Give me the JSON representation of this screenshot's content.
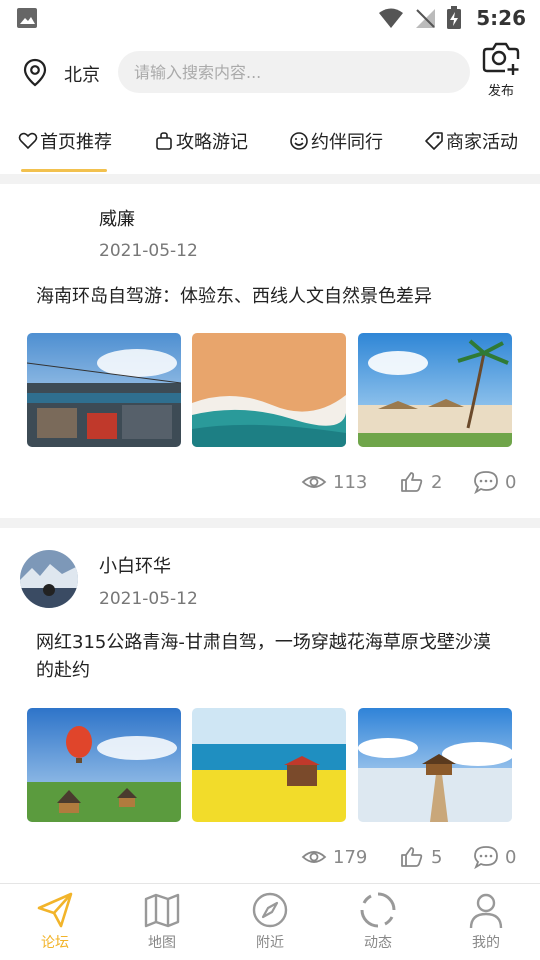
{
  "status_bar": {
    "time": "5:26"
  },
  "header": {
    "city": "北京",
    "search_placeholder": "请输入搜索内容...",
    "publish_label": "发布"
  },
  "tabs": [
    {
      "label": "首页推荐",
      "icon": "heart-icon"
    },
    {
      "label": "攻略游记",
      "icon": "bag-icon"
    },
    {
      "label": "约伴同行",
      "icon": "smile-icon"
    },
    {
      "label": "商家活动",
      "icon": "tag-icon"
    }
  ],
  "posts": [
    {
      "author": "威廉",
      "date": "2021-05-12",
      "title": "海南环岛自驾游：体验东、西线人文自然景色差异",
      "views": "113",
      "likes": "2",
      "comments": "0"
    },
    {
      "author": "小白环华",
      "date": "2021-05-12",
      "title": "网红315公路青海-甘肃自驾，一场穿越花海草原戈壁沙漠的赴约",
      "views": "179",
      "likes": "5",
      "comments": "0"
    }
  ],
  "bottom_nav": [
    {
      "label": "论坛",
      "icon": "paper-plane-icon",
      "active": true
    },
    {
      "label": "地图",
      "icon": "map-icon",
      "active": false
    },
    {
      "label": "附近",
      "icon": "compass-icon",
      "active": false
    },
    {
      "label": "动态",
      "icon": "loading-ring-icon",
      "active": false
    },
    {
      "label": "我的",
      "icon": "person-icon",
      "active": false
    }
  ],
  "colors": {
    "accent": "#f2b42a",
    "underline": "#f2c14e",
    "muted": "#888888"
  }
}
